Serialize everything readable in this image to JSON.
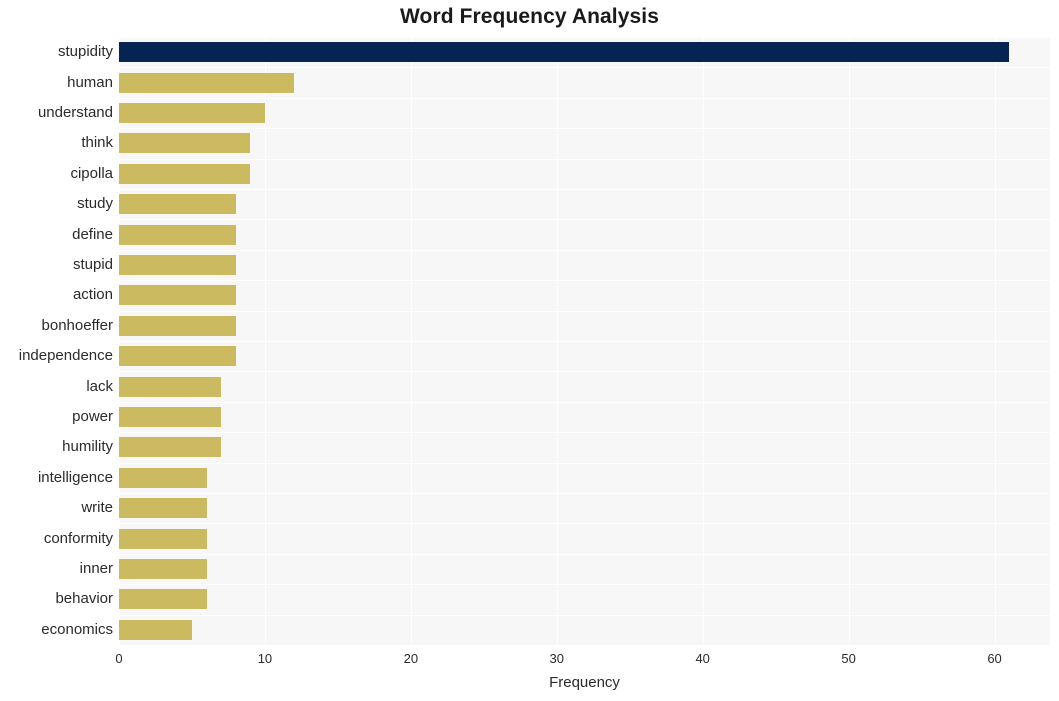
{
  "chart_data": {
    "type": "bar",
    "orientation": "horizontal",
    "title": "Word Frequency Analysis",
    "xlabel": "Frequency",
    "ylabel": "",
    "categories": [
      "stupidity",
      "human",
      "understand",
      "think",
      "cipolla",
      "study",
      "define",
      "stupid",
      "action",
      "bonhoeffer",
      "independence",
      "lack",
      "power",
      "humility",
      "intelligence",
      "write",
      "conformity",
      "inner",
      "behavior",
      "economics"
    ],
    "values": [
      61,
      12,
      10,
      9,
      9,
      8,
      8,
      8,
      8,
      8,
      8,
      7,
      7,
      7,
      6,
      6,
      6,
      6,
      6,
      5
    ],
    "xlim": [
      0,
      63.8
    ],
    "xticks": [
      0,
      10,
      20,
      30,
      40,
      50,
      60
    ],
    "xtick_labels": [
      "0",
      "10",
      "20",
      "30",
      "40",
      "50",
      "60"
    ],
    "grid": true,
    "legend": false,
    "bar_colors": {
      "highlight": "#062451",
      "default": "#cbba5f"
    },
    "highlight_category": "stupidity",
    "plot_background": "#f7f7f7",
    "figure_background": "#ffffff",
    "gridline_color": "#ffffff"
  }
}
